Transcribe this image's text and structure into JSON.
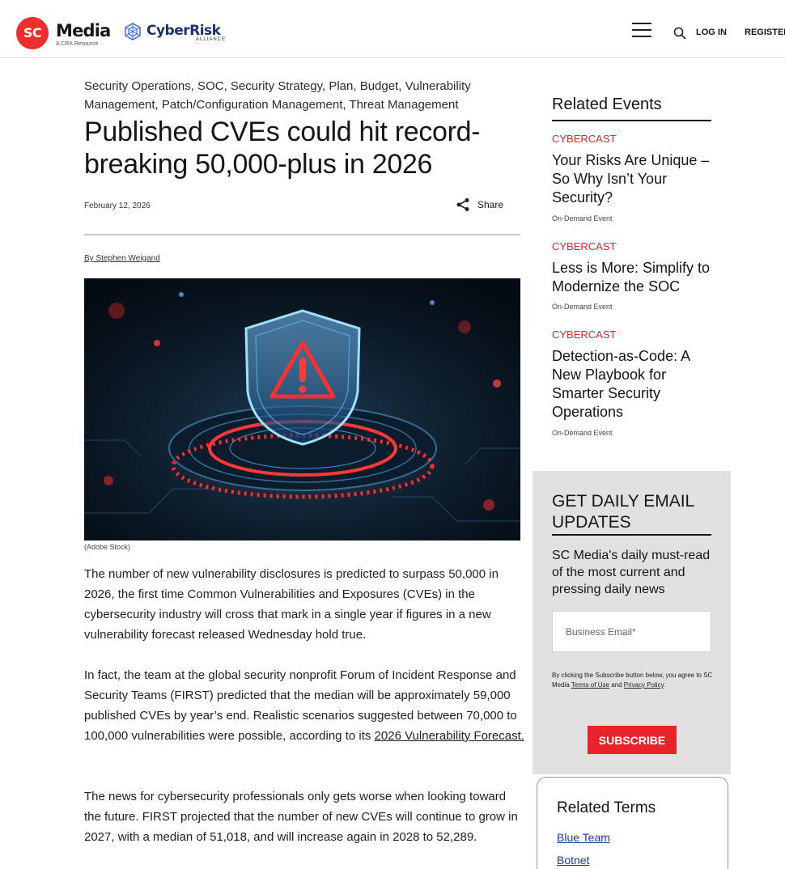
{
  "header": {
    "logo_sc": "SC",
    "logo_media": "Media",
    "logo_tagline": "A CRA Resource",
    "logo_cyberrisk": "CyberRisk",
    "logo_alliance": "ALLIANCE",
    "login": "LOG IN",
    "register": "REGISTER"
  },
  "article": {
    "categories": "Security Operations, SOC, Security Strategy, Plan, Budget, Vulnerability Management, Patch/Configuration Management, Threat Management",
    "title": "Published CVEs could hit record-breaking 50,000-plus in 2026",
    "date": "February 12, 2026",
    "share_label": "Share",
    "byline": "By Stephen Weigand",
    "image_caption": "(Adobe Stock)",
    "paragraph1": "The number of new vulnerability disclosures is predicted to surpass 50,000 in 2026, the first time Common Vulnerabilities and Exposures (CVEs) in the cybersecurity industry will cross that mark in a single year if figures in a new vulnerability forecast released Wednesday hold true.",
    "paragraph2_text": "In fact, the team at the global security nonprofit Forum of Incident Response and Security Teams (FIRST) predicted that the median will be approximately 59,000 published CVEs by year’s end. Realistic scenarios suggested between 70,000 to 100,000 vulnerabilities were possible, according to its ",
    "paragraph2_link": "2026 Vulnerability Forecast.",
    "paragraph3": "The news for cybersecurity professionals only gets worse when looking toward the future. FIRST projected that the number of new CVEs will continue to grow in 2027, with a median of 51,018, and will increase again in 2028 to 52,289."
  },
  "sidebar": {
    "related_events_title": "Related Events",
    "events": [
      {
        "tag": "CYBERCAST",
        "title": "Your Risks Are Unique – So Why Isn’t Your Security?",
        "type": "On-Demand Event"
      },
      {
        "tag": "CYBERCAST",
        "title": "Less is More: Simplify to Modernize the SOC",
        "type": "On-Demand Event"
      },
      {
        "tag": "CYBERCAST",
        "title": "Detection-as-Code: A New Playbook for Smarter Security Operations",
        "type": "On-Demand Event"
      }
    ],
    "email": {
      "title": "GET DAILY EMAIL UPDATES",
      "description": "SC Media's daily must-read of the most current and pressing daily news",
      "placeholder": "Business Email*",
      "legal_prefix": "By clicking the Subscribe button below, you agree to SC Media ",
      "legal_terms": "Terms of Use",
      "legal_and": " and ",
      "legal_privacy": "Privacy Policy",
      "legal_suffix": ".",
      "subscribe_label": "SUBSCRIBE"
    },
    "related_terms_title": "Related Terms",
    "terms": [
      "Blue Team",
      "Botnet"
    ]
  },
  "colors": {
    "accent_red": "#e8232c",
    "link_blue": "#1a3a9c",
    "brand_navy": "#1f2f6b"
  }
}
